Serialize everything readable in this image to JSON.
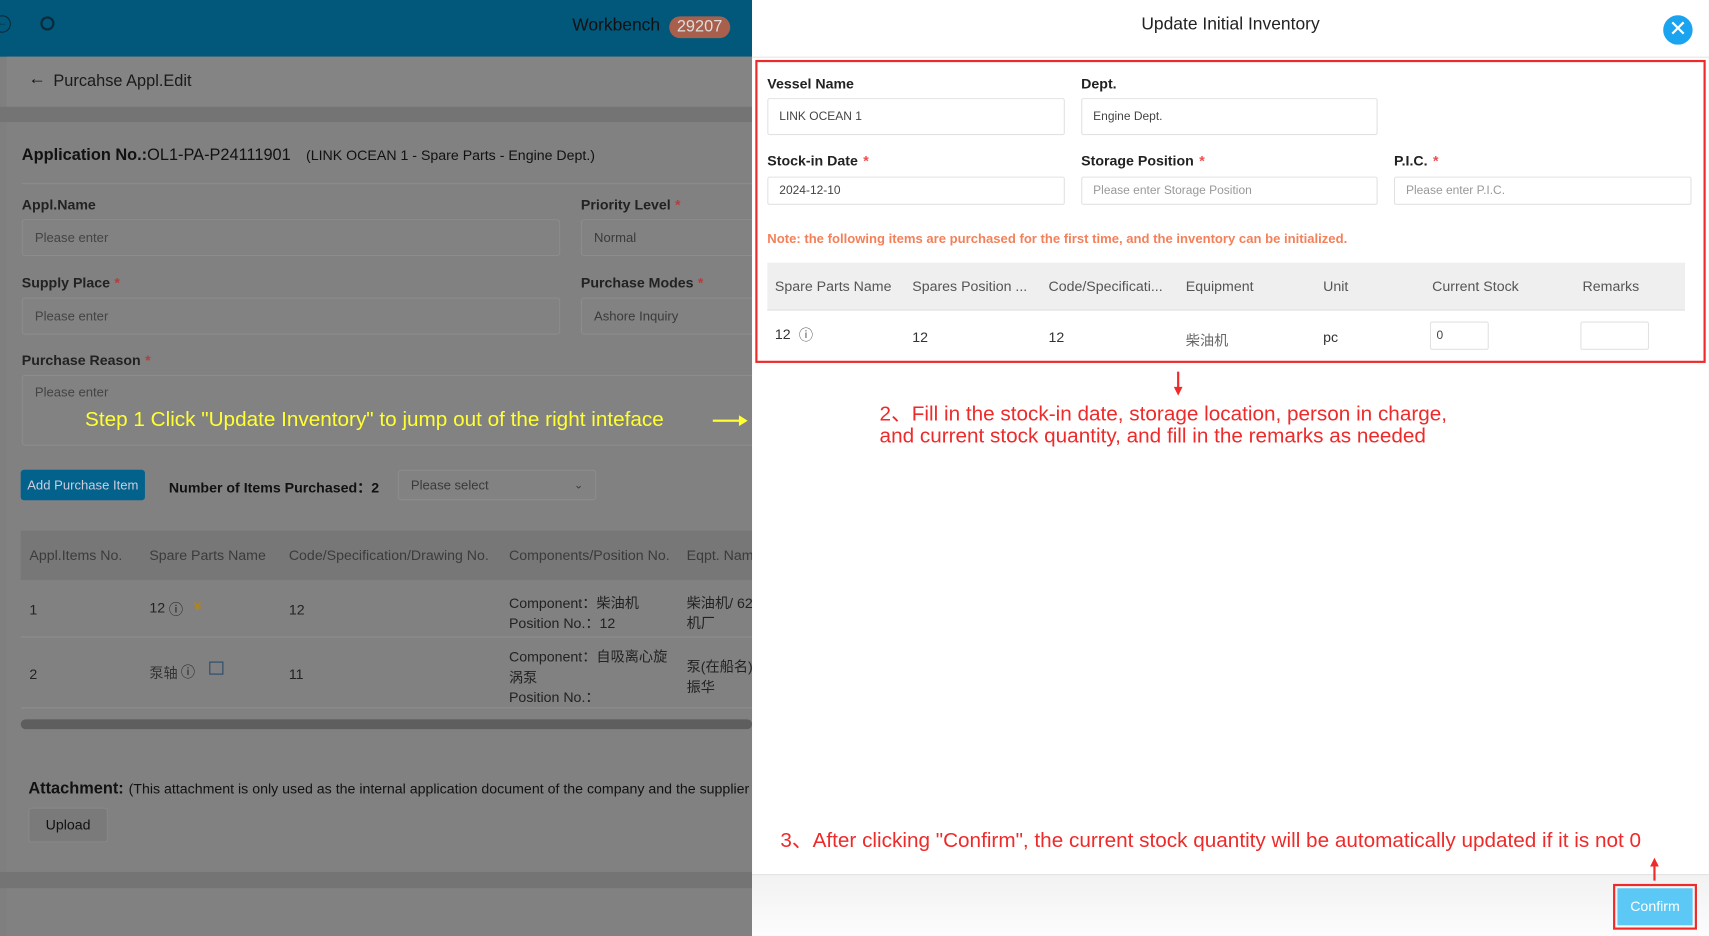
{
  "header": {
    "workbench_label": "Workbench",
    "badge_count": "29207",
    "icons": [
      "back-circle-icon",
      "search-icon"
    ]
  },
  "breadcrumb": {
    "title": "Purcahse Appl.Edit"
  },
  "form": {
    "app_no_label": "Application No.:",
    "app_no": "OL1-PA-P24111901",
    "app_context": "(LINK OCEAN 1 - Spare Parts - Engine Dept.)",
    "appl_name_label": "Appl.Name",
    "appl_name_placeholder": "Please enter",
    "priority_label": "Priority Level",
    "priority_value": "Normal",
    "supply_label": "Supply Place",
    "supply_placeholder": "Please enter",
    "modes_label": "Purchase Modes",
    "modes_value": "Ashore Inquiry",
    "reason_label": "Purchase Reason",
    "reason_placeholder": "Please enter",
    "required_mark": "*"
  },
  "annotations": {
    "step1": "Step 1 Click \"Update Inventory\" to jump out of the right inteface",
    "step2_line1": "2、Fill in the stock-in date, storage location, person in charge,",
    "step2_line2": "and current stock quantity, and fill in the remarks as needed",
    "step3": "3、After clicking \"Confirm\", the current stock quantity will be automatically updated if it is not 0"
  },
  "items": {
    "add_button": "Add Purchase Item",
    "count_label": "Number of Items Purchased：",
    "count": "2",
    "select_placeholder": "Please select",
    "columns": [
      "Appl.Items No.",
      "Spare Parts Name",
      "Code/Specification/Drawing No.",
      "Components/Position No.",
      "Eqpt. Nam"
    ],
    "rows": [
      {
        "no": "1",
        "name": "12",
        "code": "12",
        "component": "Component：柴油机",
        "position": "Position No.：12",
        "eqpt1": "柴油机/ 62",
        "eqpt2": "机厂"
      },
      {
        "no": "2",
        "name": "泵轴",
        "code": "11",
        "component": "Component：自吸离心旋",
        "component2": "涡泵",
        "position": "Position No.：",
        "eqpt1": "泵(在船名)",
        "eqpt2": "振华"
      }
    ]
  },
  "attachment": {
    "label": "Attachment:",
    "note": "(This attachment is only used as the internal application document of the company and the supplier c",
    "upload": "Upload"
  },
  "dialog": {
    "title": "Update Initial Inventory",
    "vessel_label": "Vessel Name",
    "vessel_value": "LINK OCEAN 1",
    "dept_label": "Dept.",
    "dept_value": "Engine Dept.",
    "date_label": "Stock-in Date",
    "date_value": "2024-12-10",
    "storage_label": "Storage Position",
    "storage_placeholder": "Please enter Storage Position",
    "pic_label": "P.I.C.",
    "pic_placeholder": "Please enter P.I.C.",
    "note": "Note: the following items are purchased for the first time, and the inventory can be initialized.",
    "columns": [
      "Spare Parts Name",
      "Spares Position ...",
      "Code/Specificati...",
      "Equipment",
      "Unit",
      "Current Stock",
      "Remarks"
    ],
    "row": {
      "name": "12",
      "position": "12",
      "code": "12",
      "equipment": "柴油机",
      "unit": "pc",
      "stock": "0",
      "remarks": ""
    },
    "confirm": "Confirm",
    "colors": {
      "close": "#1aa3ee",
      "confirm": "#5bc8f5",
      "note": "#f4805a",
      "annotation": "#ee2a2a"
    }
  }
}
